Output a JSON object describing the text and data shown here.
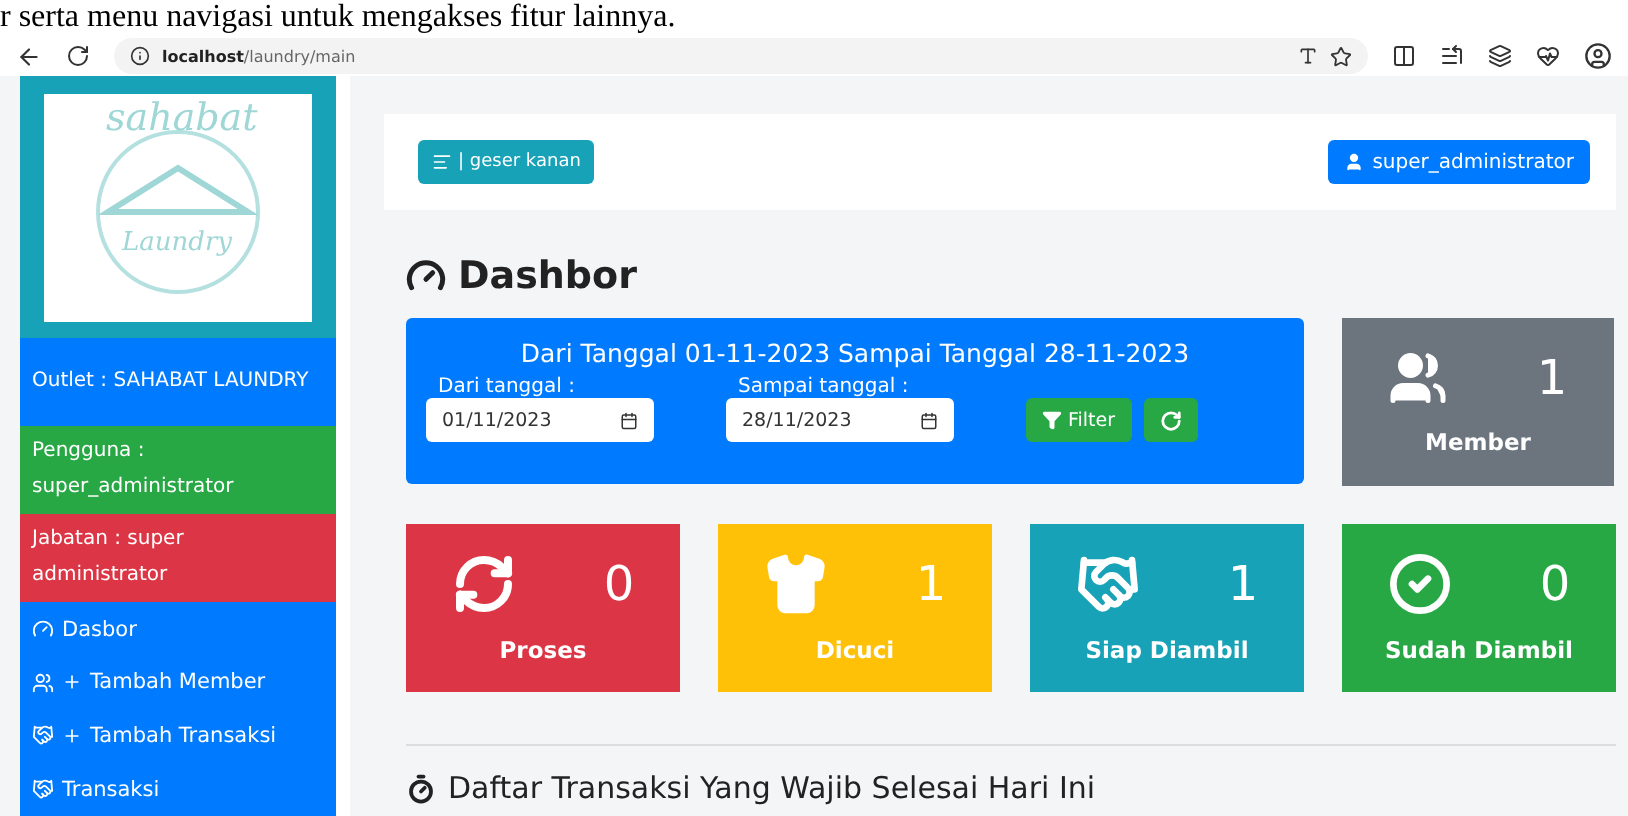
{
  "document_text": "r serta menu navigasi untuk mengakses fitur lainnya.",
  "browser": {
    "url_host": "localhost",
    "url_path": "/laundry/main"
  },
  "logo": {
    "top": "sahabat",
    "bottom": "Laundry"
  },
  "sidebar": {
    "info": [
      {
        "text": "Outlet : SAHABAT LAUNDRY",
        "color": "#007bff"
      },
      {
        "text": "Pengguna : super_administrator",
        "color": "#28a745"
      },
      {
        "text": "Jabatan : super administrator",
        "color": "#dc3545"
      }
    ],
    "menu": [
      {
        "label": "Dasbor",
        "kind": "dashboard"
      },
      {
        "label": "Tambah Member",
        "kind": "add-member"
      },
      {
        "label": "Tambah Transaksi",
        "kind": "add-transaction"
      },
      {
        "label": "Transaksi",
        "kind": "transaction"
      }
    ]
  },
  "topbar": {
    "toggle": "| geser kanan",
    "user": "super_administrator"
  },
  "page_title": "Dashbor",
  "filter": {
    "heading": "Dari Tanggal 01-11-2023 Sampai Tanggal 28-11-2023",
    "from_label": "Dari tanggal :",
    "from_value": "01/11/2023",
    "to_label": "Sampai tanggal :",
    "to_value": "28/11/2023",
    "filter_button": "Filter"
  },
  "member_card": {
    "count": "1",
    "label": "Member",
    "color": "#6c757d"
  },
  "stats": [
    {
      "kind": "process",
      "count": "0",
      "label": "Proses",
      "color": "#dc3545"
    },
    {
      "kind": "washing",
      "count": "1",
      "label": "Dicuci",
      "color": "#ffc107"
    },
    {
      "kind": "ready",
      "count": "1",
      "label": "Siap Diambil",
      "color": "#17a2b8"
    },
    {
      "kind": "done",
      "count": "0",
      "label": "Sudah Diambil",
      "color": "#28a745"
    }
  ],
  "section_title": "Daftar Transaksi Yang Wajib Selesai Hari Ini"
}
